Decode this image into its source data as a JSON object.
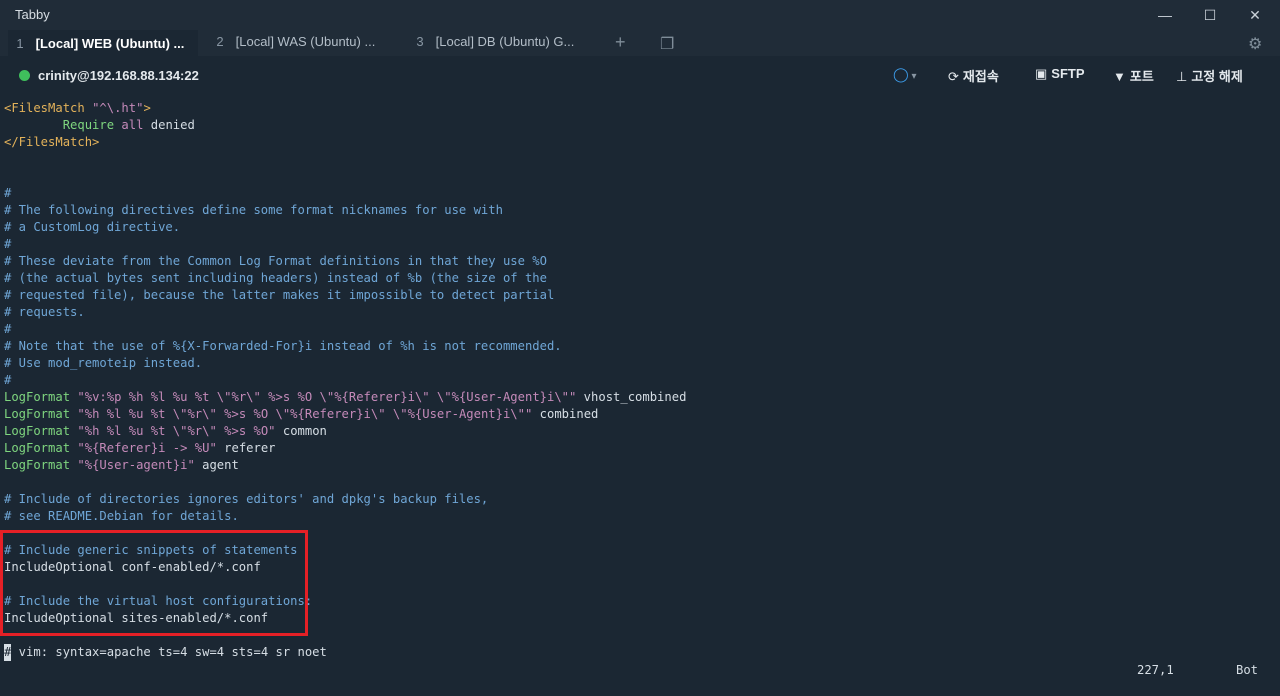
{
  "window": {
    "title": "Tabby"
  },
  "tabs": [
    {
      "num": "1",
      "label": "[Local] WEB (Ubuntu) ..."
    },
    {
      "num": "2",
      "label": "[Local] WAS (Ubuntu) ..."
    },
    {
      "num": "3",
      "label": "[Local] DB (Ubuntu) G..."
    }
  ],
  "toolbar": {
    "connection": "crinity@192.168.88.134:22",
    "reconnect": "재접속",
    "sftp": "SFTP",
    "ports": "포트",
    "unpin": "고정 해제"
  },
  "editor": {
    "lines": [
      {
        "t": "<FilesMatch \"^\\.ht\">",
        "k": "tag"
      },
      {
        "t": "        Require all denied",
        "k": "req"
      },
      {
        "t": "</FilesMatch>",
        "k": "tag"
      },
      {
        "t": "",
        "k": "n"
      },
      {
        "t": "",
        "k": "n"
      },
      {
        "t": "#",
        "k": "c"
      },
      {
        "t": "# The following directives define some format nicknames for use with",
        "k": "c"
      },
      {
        "t": "# a CustomLog directive.",
        "k": "c"
      },
      {
        "t": "#",
        "k": "c"
      },
      {
        "t": "# These deviate from the Common Log Format definitions in that they use %O",
        "k": "c"
      },
      {
        "t": "# (the actual bytes sent including headers) instead of %b (the size of the",
        "k": "c"
      },
      {
        "t": "# requested file), because the latter makes it impossible to detect partial",
        "k": "c"
      },
      {
        "t": "# requests.",
        "k": "c"
      },
      {
        "t": "#",
        "k": "c"
      },
      {
        "t": "# Note that the use of %{X-Forwarded-For}i instead of %h is not recommended.",
        "k": "c"
      },
      {
        "t": "# Use mod_remoteip instead.",
        "k": "c"
      },
      {
        "t": "#",
        "k": "c"
      },
      {
        "t": "LogFormat \"%v:%p %h %l %u %t \\\"%r\\\" %>s %O \\\"%{Referer}i\\\" \\\"%{User-Agent}i\\\"\" vhost_combined",
        "k": "lf"
      },
      {
        "t": "LogFormat \"%h %l %u %t \\\"%r\\\" %>s %O \\\"%{Referer}i\\\" \\\"%{User-Agent}i\\\"\" combined",
        "k": "lf"
      },
      {
        "t": "LogFormat \"%h %l %u %t \\\"%r\\\" %>s %O\" common",
        "k": "lf"
      },
      {
        "t": "LogFormat \"%{Referer}i -> %U\" referer",
        "k": "lf"
      },
      {
        "t": "LogFormat \"%{User-agent}i\" agent",
        "k": "lf"
      },
      {
        "t": "",
        "k": "n"
      },
      {
        "t": "# Include of directories ignores editors' and dpkg's backup files,",
        "k": "c"
      },
      {
        "t": "# see README.Debian for details.",
        "k": "c"
      },
      {
        "t": "",
        "k": "n"
      },
      {
        "t": "# Include generic snippets of statements",
        "k": "c"
      },
      {
        "t": "IncludeOptional conf-enabled/*.conf",
        "k": "n"
      },
      {
        "t": "",
        "k": "n"
      },
      {
        "t": "# Include the virtual host configurations:",
        "k": "c"
      },
      {
        "t": "IncludeOptional sites-enabled/*.conf",
        "k": "n"
      },
      {
        "t": "",
        "k": "n"
      },
      {
        "t": "# vim: syntax=apache ts=4 sw=4 sts=4 sr noet",
        "k": "c"
      }
    ],
    "cursor_line": "227,1",
    "scroll_pos": "Bot"
  },
  "colors": {
    "highlight_box": "#e52026",
    "accent": "#3c9be8",
    "status": "#3fbf5c"
  }
}
